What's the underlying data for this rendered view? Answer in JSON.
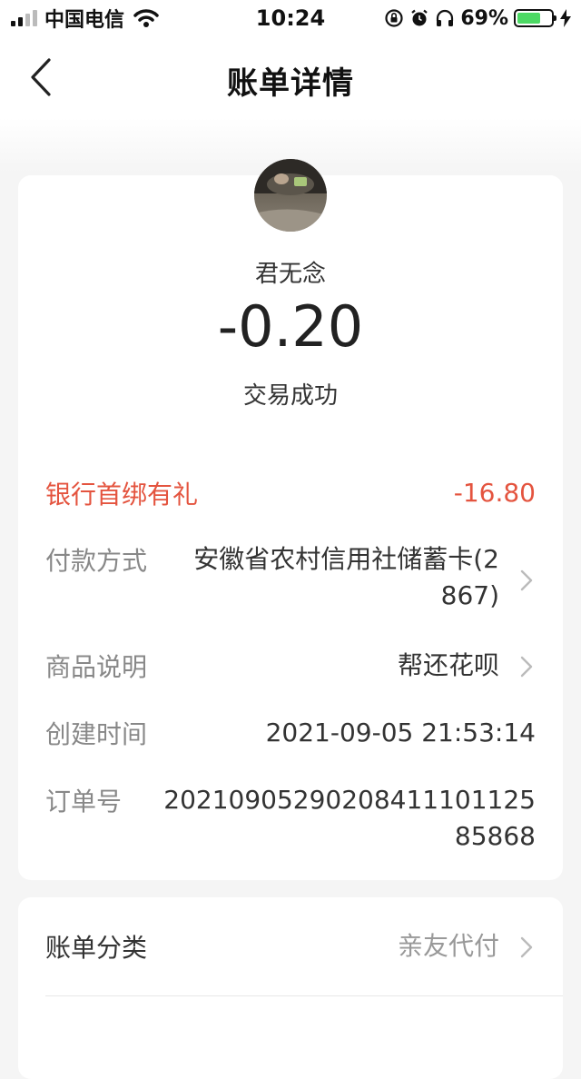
{
  "status_bar": {
    "carrier": "中国电信",
    "time": "10:24",
    "battery_percent_text": "69%",
    "battery_level": 0.69,
    "icons": [
      "signal-icon",
      "wifi-icon",
      "rotation-lock-icon",
      "alarm-icon",
      "headphones-icon",
      "battery-icon",
      "charging-bolt-icon"
    ]
  },
  "nav": {
    "title": "账单详情",
    "back_icon": "chevron-left-icon"
  },
  "summary": {
    "payee": "君无念",
    "amount": "-0.20",
    "status": "交易成功"
  },
  "details": {
    "promo": {
      "label": "银行首绑有礼",
      "value": "-16.80"
    },
    "payment": {
      "label": "付款方式",
      "value_line1": "安徽省农村信用社储蓄卡(2",
      "value_line2": "867)"
    },
    "product": {
      "label": "商品说明",
      "value": "帮还花呗"
    },
    "created": {
      "label": "创建时间",
      "value": "2021-09-05 21:53:14"
    },
    "order": {
      "label": "订单号",
      "value_line1": "20210905290208411101125",
      "value_line2": "85868"
    }
  },
  "category": {
    "label": "账单分类",
    "value": "亲友代付"
  },
  "colors": {
    "accent_red": "#e4543f",
    "battery_green": "#4cd964",
    "background": "#f5f5f5"
  }
}
